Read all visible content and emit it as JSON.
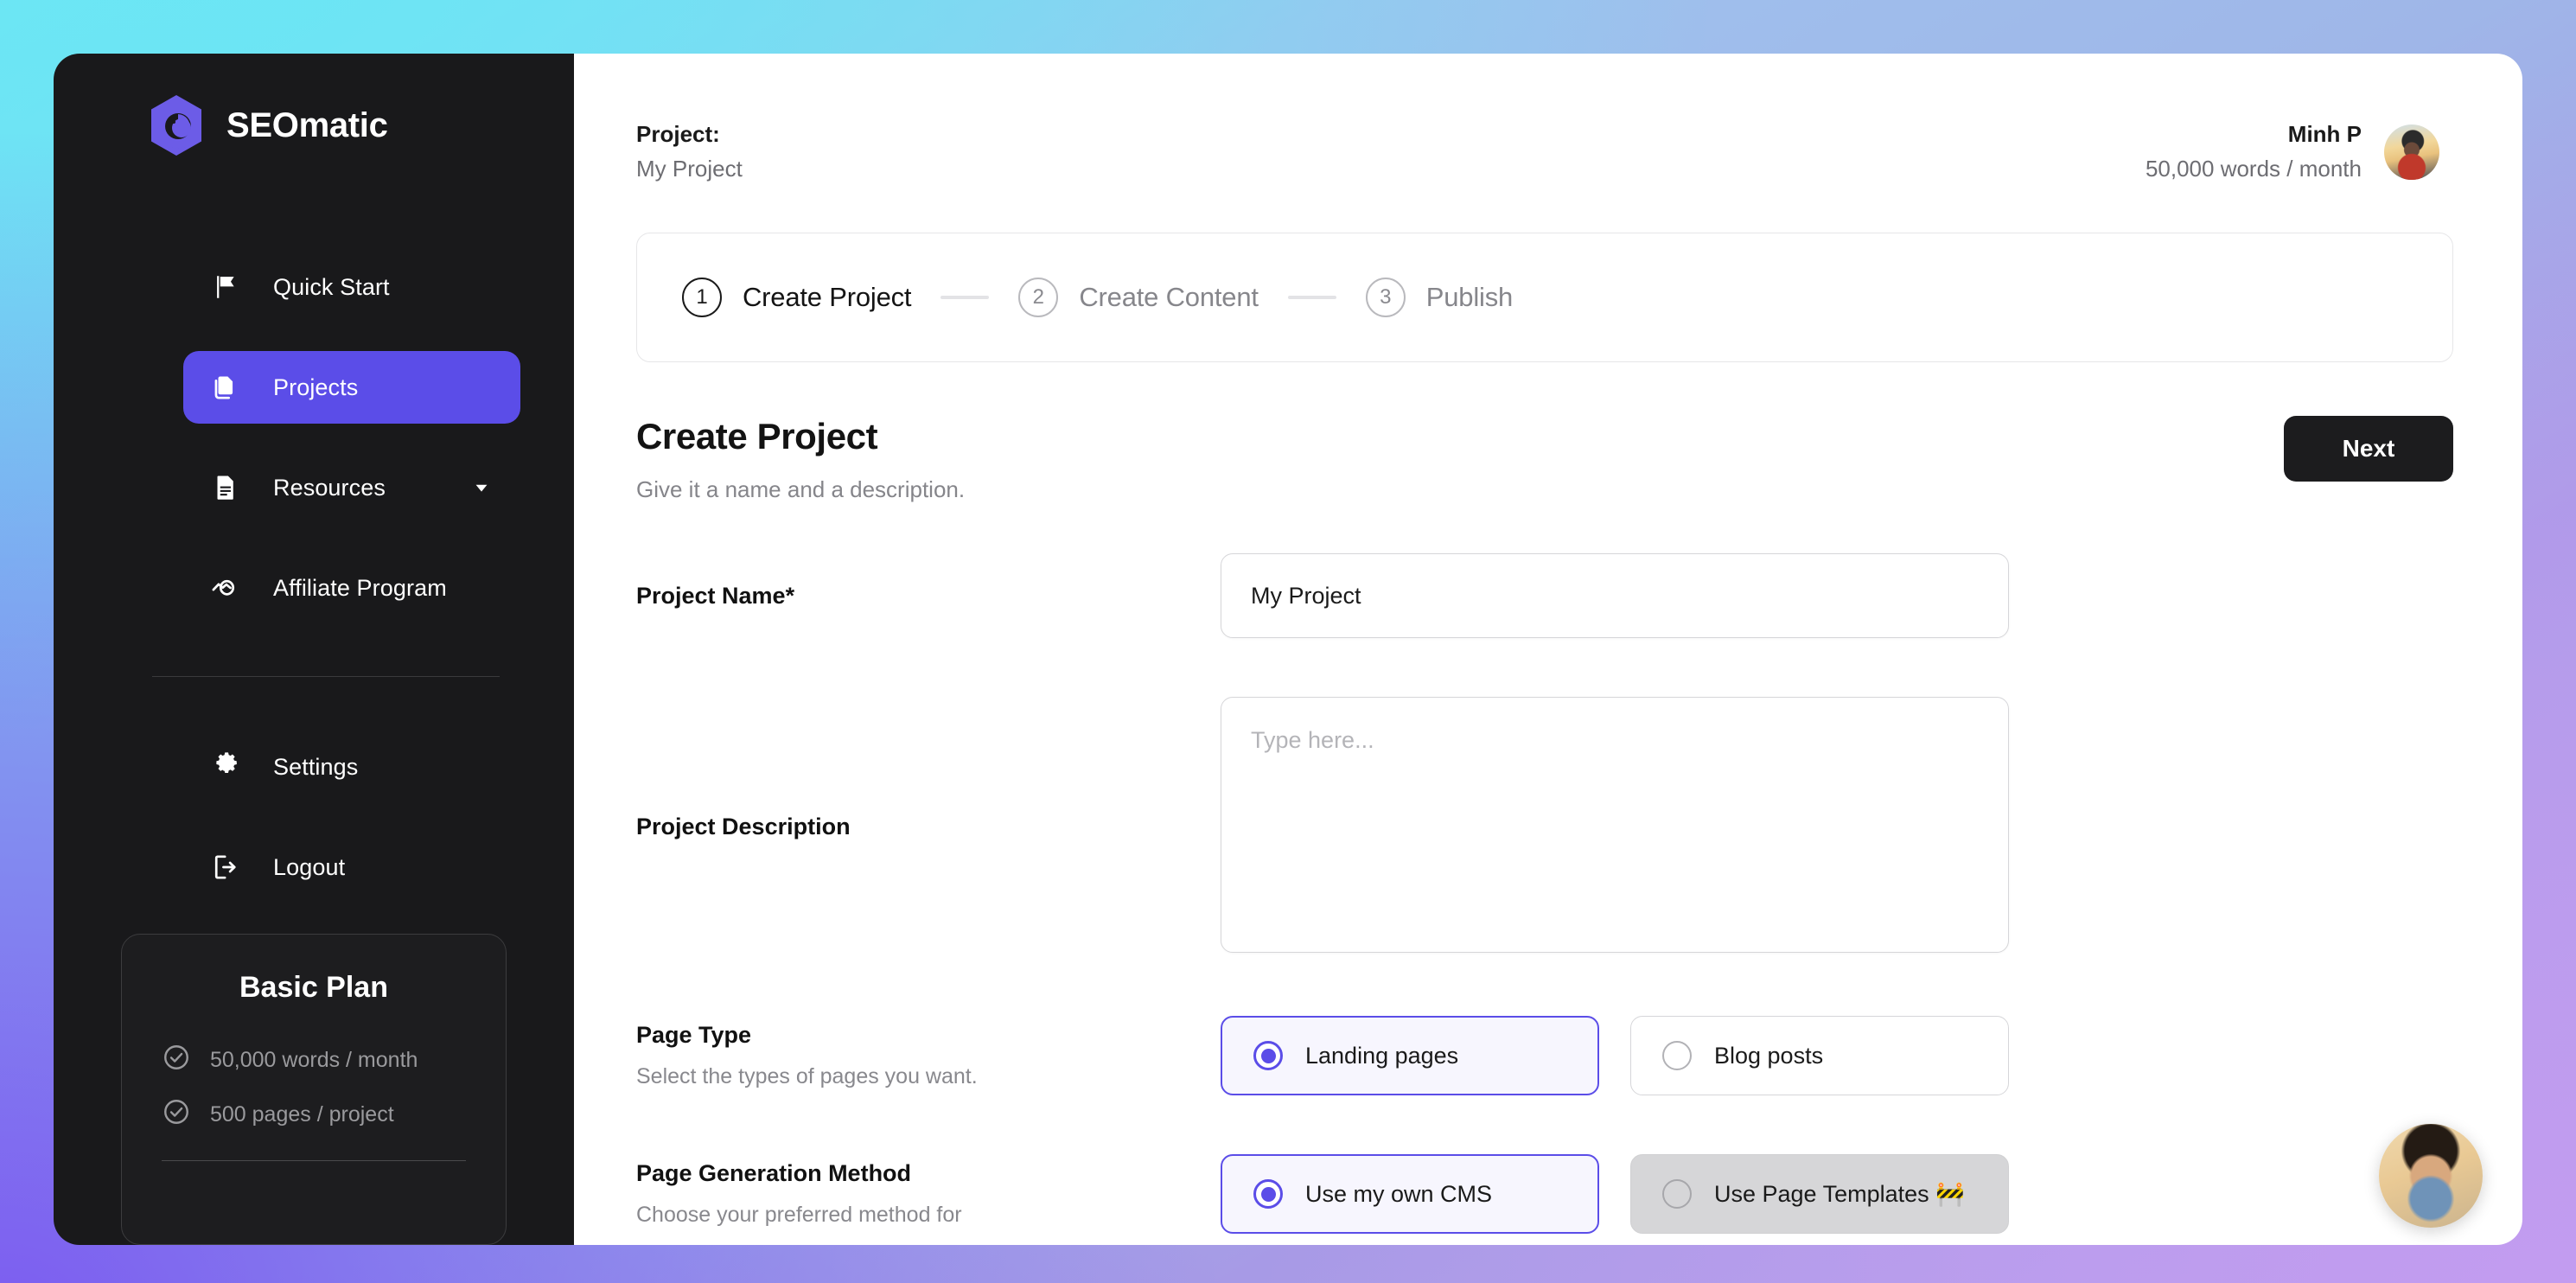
{
  "brand": {
    "name": "SEOmatic",
    "logo_icon": "seomatic-hexagon-logo"
  },
  "sidebar": {
    "items": [
      {
        "label": "Quick Start",
        "icon": "flag-icon",
        "active": false
      },
      {
        "label": "Projects",
        "icon": "copy-documents-icon",
        "active": true
      },
      {
        "label": "Resources",
        "icon": "document-lines-icon",
        "active": false,
        "chevron": "chevron-down-icon"
      },
      {
        "label": "Affiliate Program",
        "icon": "handshake-icon",
        "active": false
      }
    ],
    "lower_items": [
      {
        "label": "Settings",
        "icon": "gear-icon"
      },
      {
        "label": "Logout",
        "icon": "logout-icon"
      }
    ],
    "plan": {
      "title": "Basic Plan",
      "features": [
        "50,000 words / month",
        "500 pages / project"
      ],
      "feature_icon": "check-circle-icon"
    }
  },
  "topbar": {
    "project_label": "Project:",
    "project_value": "My Project",
    "user_name": "Minh P",
    "user_quota": "50,000 words / month",
    "avatar_icon": "user-avatar-photo"
  },
  "stepper": {
    "steps": [
      {
        "number": "1",
        "label": "Create Project",
        "active": true
      },
      {
        "number": "2",
        "label": "Create Content",
        "active": false
      },
      {
        "number": "3",
        "label": "Publish",
        "active": false
      }
    ]
  },
  "page": {
    "title": "Create Project",
    "subtitle": "Give it a name and a description.",
    "next_label": "Next"
  },
  "form": {
    "project_name": {
      "label": "Project Name*",
      "value": "My Project",
      "placeholder": "Type here..."
    },
    "project_description": {
      "label": "Project Description",
      "value": "",
      "placeholder": "Type here..."
    },
    "page_type": {
      "label": "Page Type",
      "help": "Select the types of pages you want.",
      "options": [
        {
          "label": "Landing pages",
          "selected": true,
          "disabled": false
        },
        {
          "label": "Blog posts",
          "selected": false,
          "disabled": false
        }
      ]
    },
    "page_generation_method": {
      "label": "Page Generation Method",
      "help": "Choose your preferred method for",
      "options": [
        {
          "label": "Use my own CMS",
          "selected": true,
          "disabled": false
        },
        {
          "label": "Use Page Templates 🚧",
          "selected": false,
          "disabled": true
        }
      ]
    }
  },
  "chat": {
    "icon": "support-agent-avatar"
  },
  "colors": {
    "accent": "#5b4de8",
    "sidebar_bg": "#19191b",
    "button_dark": "#1c1c1e",
    "muted_text": "#86868b"
  }
}
